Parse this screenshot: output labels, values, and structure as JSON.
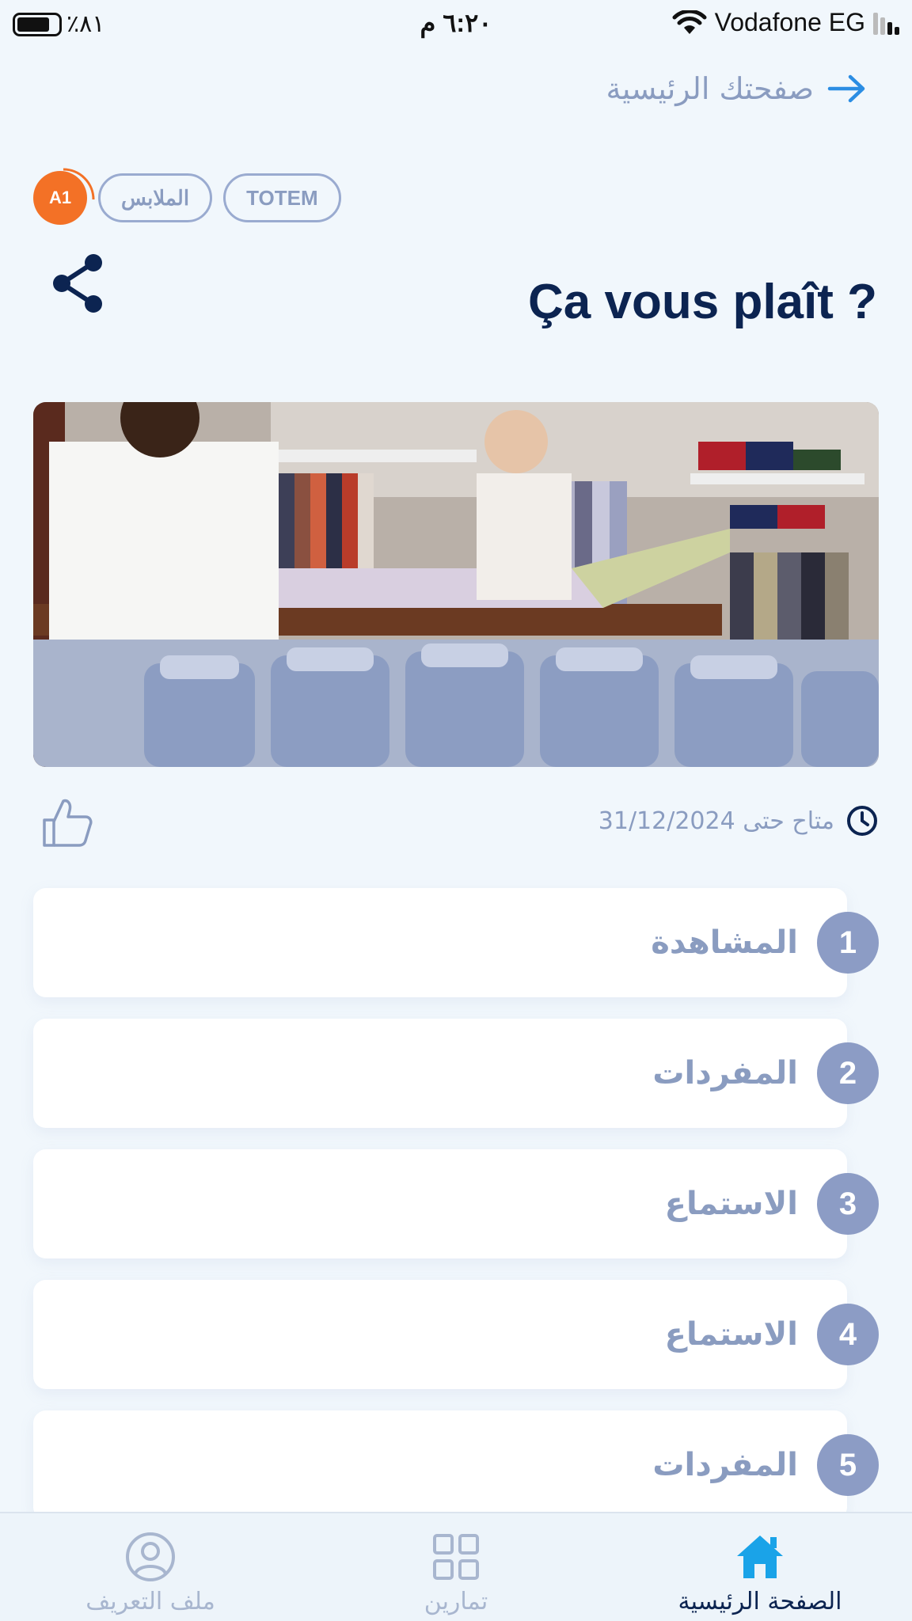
{
  "status_bar": {
    "battery": "٪٨١",
    "time": "٦:٢٠ م",
    "carrier": "Vodafone EG"
  },
  "nav": {
    "back_label": "صفحتك الرئيسية"
  },
  "tags": {
    "level": "A1",
    "category": "الملابس",
    "source": "TOTEM"
  },
  "lesson": {
    "title": "Ça vous plaît ?",
    "availability": "متاح حتى 31/12/2024"
  },
  "steps": [
    {
      "number": "1",
      "label": "المشاهدة"
    },
    {
      "number": "2",
      "label": "المفردات"
    },
    {
      "number": "3",
      "label": "الاستماع"
    },
    {
      "number": "4",
      "label": "الاستماع"
    },
    {
      "number": "5",
      "label": "المفردات"
    }
  ],
  "tabbar": {
    "home": "الصفحة الرئيسية",
    "exercises": "تمارين",
    "profile": "ملف التعريف"
  },
  "colors": {
    "accent_orange": "#f37126",
    "home_icon_blue": "#1aa3e8",
    "title_navy": "#0c2451",
    "muted": "#8a9cc0"
  }
}
